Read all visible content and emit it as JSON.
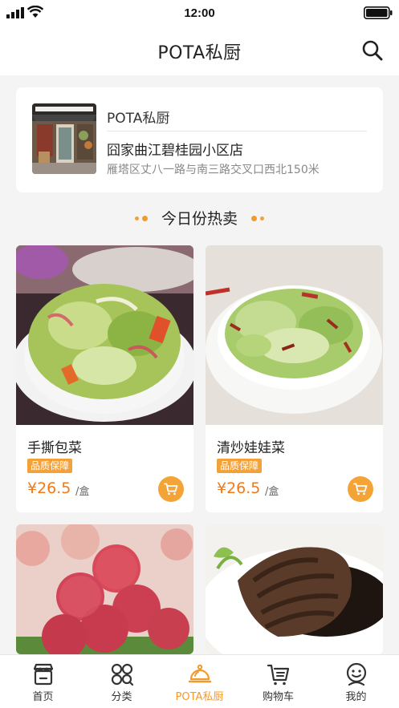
{
  "status_bar": {
    "time": "12:00"
  },
  "nav": {
    "title": "POTA私厨"
  },
  "store": {
    "brand": "POTA私厨",
    "name": "囧家曲江碧桂园小区店",
    "address": "雁塔区丈八一路与南三路交叉口西北150米"
  },
  "section": {
    "title": "今日份热卖"
  },
  "products": [
    {
      "name": "手撕包菜",
      "badge": "品质保障",
      "price": "¥26.5",
      "unit": "/盒"
    },
    {
      "name": "清炒娃娃菜",
      "badge": "品质保障",
      "price": "¥26.5",
      "unit": "/盒"
    },
    {
      "name": "",
      "badge": "",
      "price": "",
      "unit": ""
    },
    {
      "name": "",
      "badge": "",
      "price": "",
      "unit": ""
    }
  ],
  "tabs": [
    {
      "label": "首页",
      "icon": "shop-icon"
    },
    {
      "label": "分类",
      "icon": "category-icon"
    },
    {
      "label": "POTA私厨",
      "icon": "cloche-icon",
      "active": true
    },
    {
      "label": "购物车",
      "icon": "cart-icon"
    },
    {
      "label": "我的",
      "icon": "profile-icon"
    }
  ],
  "colors": {
    "accent": "#f39a2c",
    "price": "#f07a1a",
    "background": "#f4f4f4"
  }
}
